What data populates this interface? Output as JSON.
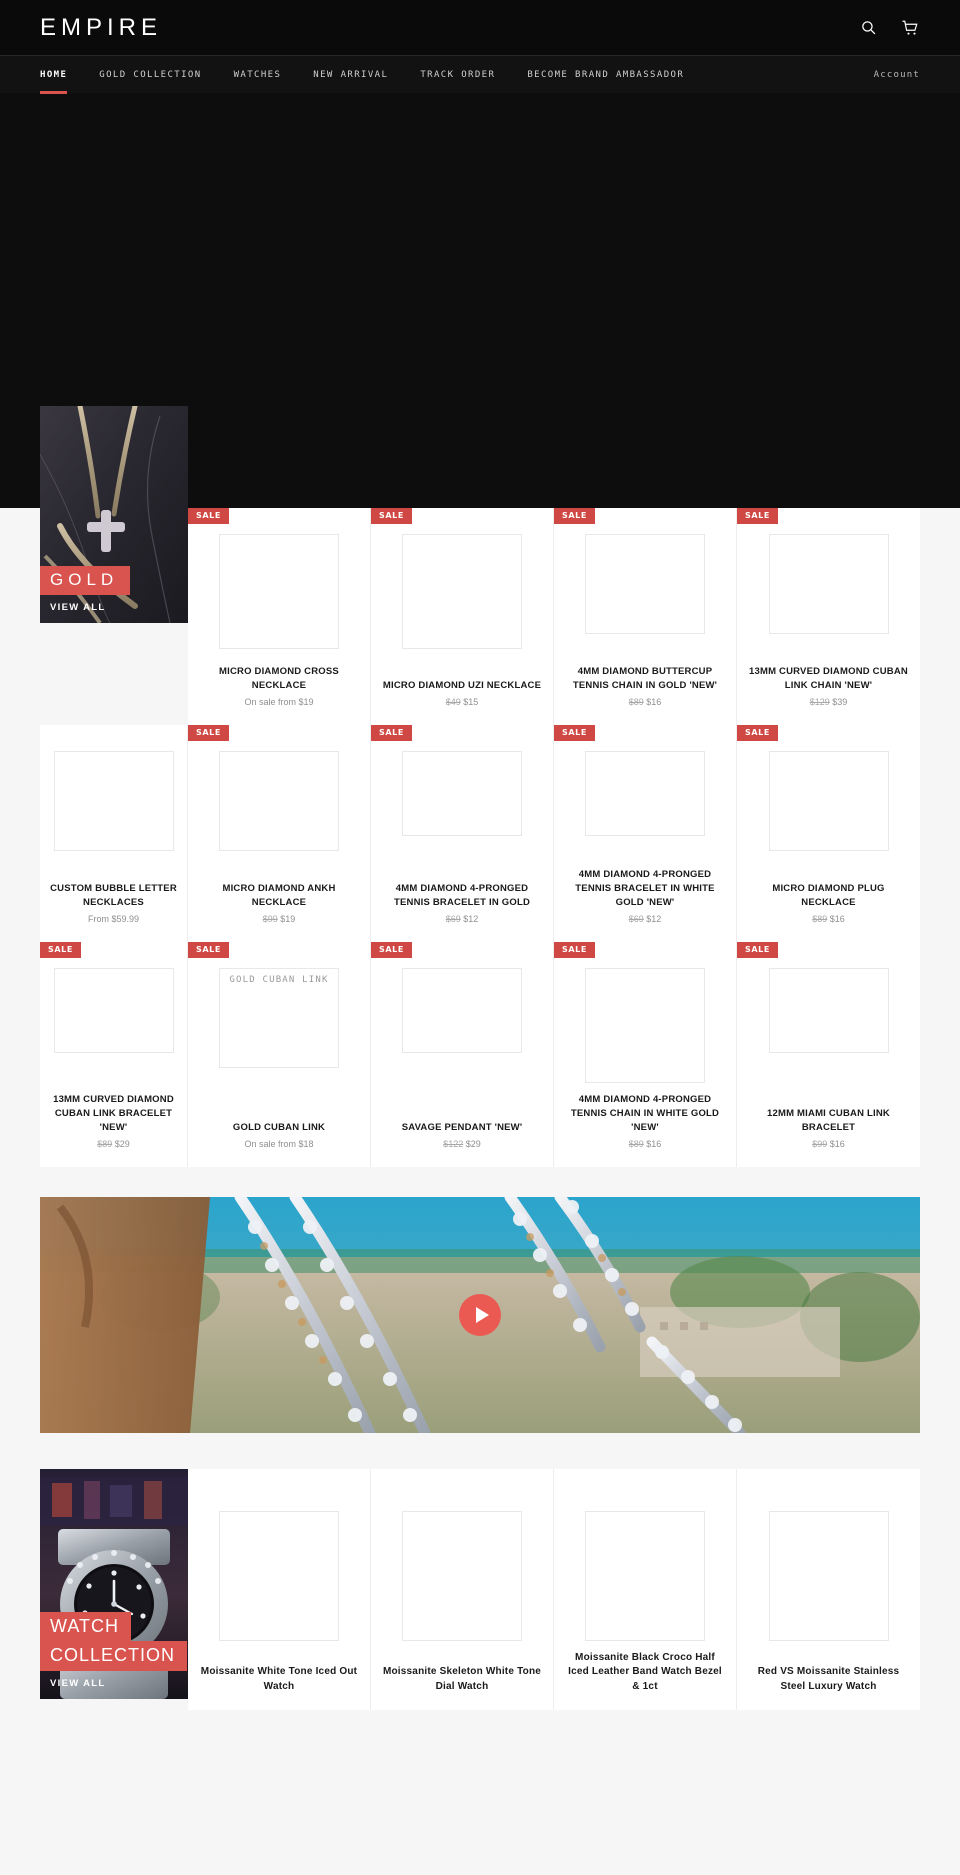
{
  "header": {
    "brand": "EMPIRE",
    "icons": [
      {
        "name": "search-icon",
        "label": "Search"
      },
      {
        "name": "cart-icon",
        "label": "Cart"
      }
    ]
  },
  "nav": {
    "items": [
      {
        "label": "HOME",
        "active": true
      },
      {
        "label": "GOLD COLLECTION",
        "active": false
      },
      {
        "label": "WATCHES",
        "active": false
      },
      {
        "label": "NEW ARRIVAL",
        "active": false
      },
      {
        "label": "TRACK ORDER",
        "active": false
      },
      {
        "label": "BECOME BRAND AMBASSADOR",
        "active": false
      }
    ],
    "account": "Account"
  },
  "gold_collection": {
    "promo": {
      "title": "GOLD",
      "view_all": "VIEW ALL"
    },
    "row1": [
      {
        "sale": "SALE",
        "title": "MICRO DIAMOND CROSS NECKLACE",
        "price_text": "On sale from $19",
        "price_old": "",
        "price_new": ""
      },
      {
        "sale": "SALE",
        "title": "MICRO DIAMOND UZI NECKLACE",
        "price_text": "",
        "price_old": "$49",
        "price_new": "$15"
      },
      {
        "sale": "SALE",
        "title": "4MM DIAMOND BUTTERCUP TENNIS CHAIN IN GOLD 'NEW'",
        "price_text": "",
        "price_old": "$89",
        "price_new": "$16"
      },
      {
        "sale": "SALE",
        "title": "13MM CURVED DIAMOND CUBAN LINK CHAIN 'NEW'",
        "price_text": "",
        "price_old": "$129",
        "price_new": "$39"
      }
    ],
    "row2": [
      {
        "sale": "",
        "title": "CUSTOM BUBBLE LETTER NECKLACES",
        "price_text": "From $59.99",
        "price_old": "",
        "price_new": ""
      },
      {
        "sale": "SALE",
        "title": "MICRO DIAMOND ANKH NECKLACE",
        "price_text": "",
        "price_old": "$99",
        "price_new": "$19"
      },
      {
        "sale": "SALE",
        "title": "4MM DIAMOND 4-PRONGED TENNIS BRACELET IN GOLD",
        "price_text": "",
        "price_old": "$69",
        "price_new": "$12"
      },
      {
        "sale": "SALE",
        "title": "4MM DIAMOND 4-PRONGED TENNIS BRACELET IN WHITE GOLD 'NEW'",
        "price_text": "",
        "price_old": "$69",
        "price_new": "$12"
      },
      {
        "sale": "SALE",
        "title": "MICRO DIAMOND PLUG NECKLACE",
        "price_text": "",
        "price_old": "$89",
        "price_new": "$16"
      }
    ],
    "row3": [
      {
        "sale": "SALE",
        "title": "13MM CURVED DIAMOND CUBAN LINK BRACELET 'NEW'",
        "price_text": "",
        "price_old": "$89",
        "price_new": "$29"
      },
      {
        "sale": "SALE",
        "title": "GOLD CUBAN LINK",
        "price_text": "On sale from $18",
        "price_old": "",
        "price_new": "",
        "image_label": "GOLD CUBAN LINK"
      },
      {
        "sale": "SALE",
        "title": "SAVAGE PENDANT 'NEW'",
        "price_text": "",
        "price_old": "$122",
        "price_new": "$29"
      },
      {
        "sale": "SALE",
        "title": "4MM DIAMOND 4-PRONGED TENNIS CHAIN IN WHITE GOLD 'NEW'",
        "price_text": "",
        "price_old": "$89",
        "price_new": "$16"
      },
      {
        "sale": "SALE",
        "title": "12MM MIAMI CUBAN LINK BRACELET",
        "price_text": "",
        "price_old": "$99",
        "price_new": "$16"
      }
    ]
  },
  "video_banner": {
    "play_label": "Play"
  },
  "watch_collection": {
    "promo": {
      "title_line1": "WATCH",
      "title_line2": "COLLECTION",
      "view_all": "VIEW ALL"
    },
    "products": [
      {
        "sale": "",
        "title": "Moissanite White Tone Iced Out Watch",
        "price_text": "",
        "price_old": "",
        "price_new": ""
      },
      {
        "sale": "",
        "title": "Moissanite Skeleton White Tone Dial Watch",
        "price_text": "",
        "price_old": "",
        "price_new": ""
      },
      {
        "sale": "",
        "title": "Moissanite Black Croco Half Iced Leather Band Watch Bezel & 1ct",
        "price_text": "",
        "price_old": "",
        "price_new": ""
      },
      {
        "sale": "",
        "title": "Red VS Moissanite Stainless Steel Luxury Watch",
        "price_text": "",
        "price_old": "",
        "price_new": ""
      }
    ]
  },
  "colors": {
    "header_bg": "#0a0a0a",
    "nav_bg": "#121212",
    "accent_red": "#d9534f",
    "sale_badge": "#cf4843",
    "play_button": "#ea5a52",
    "page_bg": "#f6f6f6"
  }
}
